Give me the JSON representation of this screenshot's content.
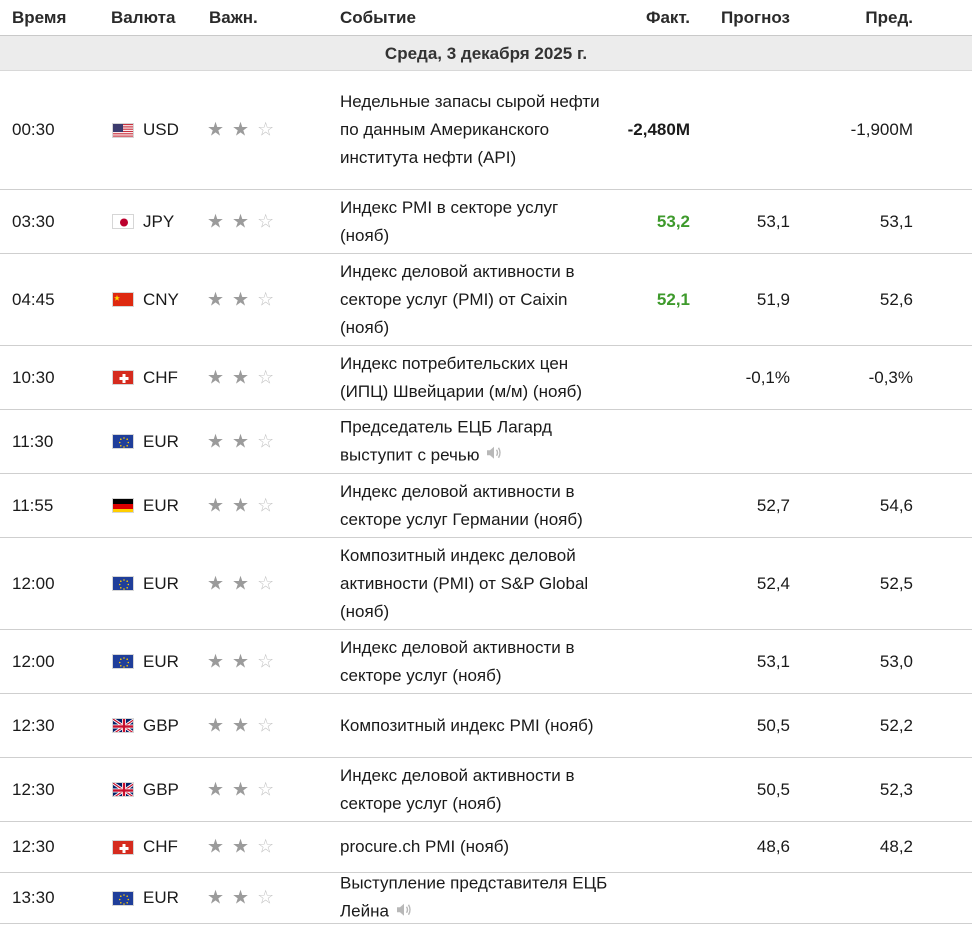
{
  "header": {
    "time": "Время",
    "currency": "Валюта",
    "importance": "Важн.",
    "event": "Событие",
    "actual": "Факт.",
    "forecast": "Прогноз",
    "previous": "Пред."
  },
  "date_label": "Среда, 3 декабря 2025 г.",
  "colors": {
    "positive": "#3e9a2c",
    "star_on": "#9b9b9b",
    "star_off": "#c4c4c4"
  },
  "events": [
    {
      "time": "00:30",
      "flag": "us-flag-icon",
      "currency": "USD",
      "stars": 2,
      "event": "Недельные запасы сырой нефти по данным Американского института нефти (API)",
      "speech": false,
      "actual": "-2,480M",
      "actual_state": "neutral",
      "forecast": "",
      "previous": "-1,900M"
    },
    {
      "time": "03:30",
      "flag": "japan-flag-icon",
      "currency": "JPY",
      "stars": 2,
      "event": "Индекс PMI в секторе услуг (нояб)",
      "speech": false,
      "actual": "53,2",
      "actual_state": "positive",
      "forecast": "53,1",
      "previous": "53,1"
    },
    {
      "time": "04:45",
      "flag": "china-flag-icon",
      "currency": "CNY",
      "stars": 2,
      "event": "Индекс деловой активности в секторе услуг (PMI) от Caixin (нояб)",
      "speech": false,
      "actual": "52,1",
      "actual_state": "positive",
      "forecast": "51,9",
      "previous": "52,6"
    },
    {
      "time": "10:30",
      "flag": "switzerland-flag-icon",
      "currency": "CHF",
      "stars": 2,
      "event": "Индекс потребительских цен (ИПЦ) Швейцарии (м/м) (нояб)",
      "speech": false,
      "actual": "",
      "actual_state": "neutral",
      "forecast": "-0,1%",
      "previous": "-0,3%"
    },
    {
      "time": "11:30",
      "flag": "eu-flag-icon",
      "currency": "EUR",
      "stars": 2,
      "event": "Председатель ЕЦБ Лагард выступит с речью",
      "speech": true,
      "actual": "",
      "actual_state": "neutral",
      "forecast": "",
      "previous": ""
    },
    {
      "time": "11:55",
      "flag": "germany-flag-icon",
      "currency": "EUR",
      "stars": 2,
      "event": "Индекс деловой активности в секторе услуг Германии (нояб)",
      "speech": false,
      "actual": "",
      "actual_state": "neutral",
      "forecast": "52,7",
      "previous": "54,6"
    },
    {
      "time": "12:00",
      "flag": "eu-flag-icon",
      "currency": "EUR",
      "stars": 2,
      "event": "Композитный индекс деловой активности (PMI) от S&P Global (нояб)",
      "speech": false,
      "actual": "",
      "actual_state": "neutral",
      "forecast": "52,4",
      "previous": "52,5"
    },
    {
      "time": "12:00",
      "flag": "eu-flag-icon",
      "currency": "EUR",
      "stars": 2,
      "event": "Индекс деловой активности в секторе услуг (нояб)",
      "speech": false,
      "actual": "",
      "actual_state": "neutral",
      "forecast": "53,1",
      "previous": "53,0"
    },
    {
      "time": "12:30",
      "flag": "uk-flag-icon",
      "currency": "GBP",
      "stars": 2,
      "event": "Композитный индекс PMI (нояб)",
      "speech": false,
      "actual": "",
      "actual_state": "neutral",
      "forecast": "50,5",
      "previous": "52,2"
    },
    {
      "time": "12:30",
      "flag": "uk-flag-icon",
      "currency": "GBP",
      "stars": 2,
      "event": "Индекс деловой активности в секторе услуг (нояб)",
      "speech": false,
      "actual": "",
      "actual_state": "neutral",
      "forecast": "50,5",
      "previous": "52,3"
    },
    {
      "time": "12:30",
      "flag": "switzerland-flag-icon",
      "currency": "CHF",
      "stars": 2,
      "event": "procure.ch PMI (нояб)",
      "speech": false,
      "actual": "",
      "actual_state": "neutral",
      "forecast": "48,6",
      "previous": "48,2"
    },
    {
      "time": "13:30",
      "flag": "eu-flag-icon",
      "currency": "EUR",
      "stars": 2,
      "event": "Выступление представителя ЕЦБ Лейна",
      "speech": true,
      "actual": "",
      "actual_state": "neutral",
      "forecast": "",
      "previous": ""
    }
  ]
}
